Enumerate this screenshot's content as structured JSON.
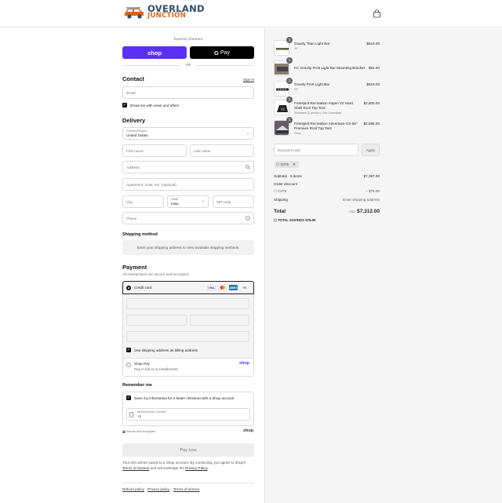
{
  "brand": {
    "line1": "OVERLAND",
    "line2": "JUNCTION",
    "primary_color": "#2f4d6b",
    "accent_color": "#d9641e"
  },
  "header": {
    "cart_icon": "shopping-bag-icon"
  },
  "express": {
    "label": "Express checkout",
    "shop_label": "shop",
    "gpay_label": "Pay",
    "or_label": "OR",
    "shop_color": "#5a31f4"
  },
  "contact": {
    "title": "Contact",
    "sign_in": "Sign in",
    "email_placeholder": "Email",
    "news_label": "Email me with news and offers"
  },
  "delivery": {
    "title": "Delivery",
    "country_label": "Country/Region",
    "country_value": "United States",
    "first_name": "First name",
    "last_name": "Last name",
    "address": "Address",
    "apartment": "Apartment, suite, etc. (optional)",
    "city": "City",
    "state_label": "State",
    "state_value": "Iowa",
    "zip": "ZIP code",
    "phone": "Phone"
  },
  "shipping": {
    "title": "Shipping method",
    "note": "Enter your shipping address to view available shipping methods."
  },
  "payment": {
    "title": "Payment",
    "subtitle": "All transactions are secure and encrypted.",
    "credit_card": "Credit card",
    "cards": [
      "VISA",
      "",
      "AMEX"
    ],
    "more_cards": "+5",
    "billing_label": "Use shipping address as billing address",
    "shop_pay": "Shop Pay",
    "shop_pay_sub": "Pay in full or in installments",
    "shop_pay_logo": "shop"
  },
  "remember": {
    "title": "Remember me",
    "save_label": "Save my information for a faster checkout with a Shop account",
    "phone_label": "Mobile phone number",
    "phone_value": "+1",
    "secure": "Secure and encrypted",
    "shop_logo": "shop"
  },
  "pay_now": "Pay now",
  "legal": {
    "text": "Your info will be saved to a Shop account. By continuing, you agree to Shop's",
    "terms": "Terms of Service",
    "and": "and acknowledge the",
    "privacy": "Privacy Policy",
    "end": "."
  },
  "footer": {
    "refund": "Refund policy",
    "privacy": "Privacy policy",
    "terms": "Terms of service"
  },
  "cart": {
    "items": [
      {
        "qty": "1",
        "name": "Gravity Titan Light Bar",
        "variant": "20\"",
        "price": "$819.00"
      },
      {
        "qty": "1",
        "name": "KC Gravity Pro6 Light Bar Mounting Bracket",
        "variant": "",
        "price": "$54.00"
      },
      {
        "qty": "1",
        "name": "Gravity Pro6 Light Bar",
        "variant": "20\"",
        "price": "$819.00"
      },
      {
        "qty": "1",
        "name": "Freespirit Recreation Aspen V2 Hard Shell Roof Top Tent",
        "variant": "Standard (2 person) / No Crossbars",
        "price": "$2,800.00"
      },
      {
        "qty": "1",
        "name": "Freespirit Recreation Adventure GS 55\" Premium Roof Top Tent",
        "variant": "Grey",
        "price": "$2,695.00"
      }
    ],
    "discount_placeholder": "Discount code",
    "apply": "Apply",
    "code": "OJ75",
    "subtotal_label": "Subtotal · 5 items",
    "subtotal": "$7,387.00",
    "order_discount": "Order discount",
    "discount_code": "OJ75",
    "discount_amount": "– $75.00",
    "shipping_label": "Shipping",
    "shipping_value": "Enter shipping address",
    "total_label": "Total",
    "currency": "USD",
    "total": "$7,312.00",
    "savings_label": "TOTAL SAVINGS",
    "savings": "$75.00"
  }
}
